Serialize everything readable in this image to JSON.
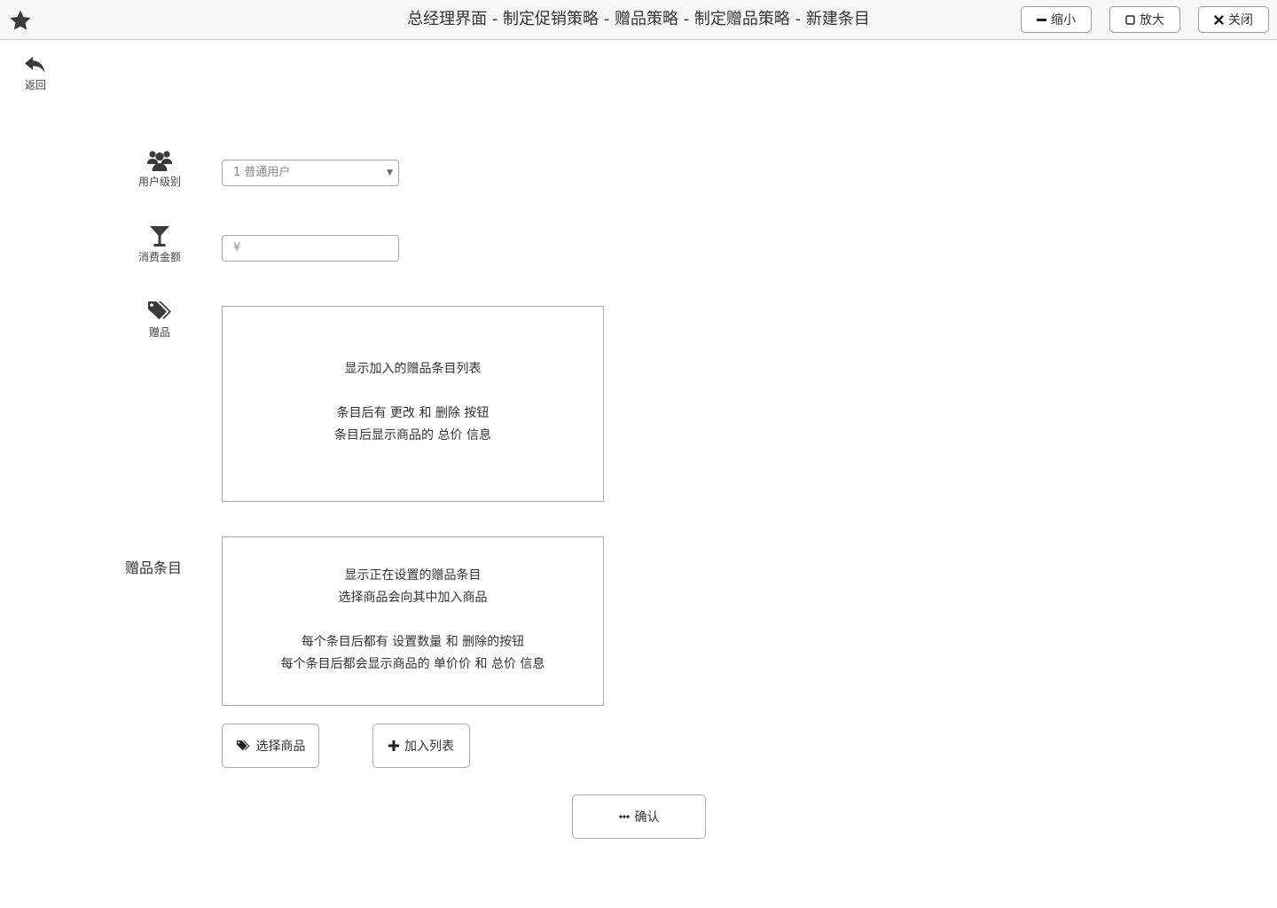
{
  "window": {
    "title": "总经理界面 - 制定促销策略 - 赠品策略 - 制定赠品策略 - 新建条目",
    "minimize_label": "缩小",
    "maximize_label": "放大",
    "close_label": "关闭"
  },
  "nav": {
    "back_label": "返回"
  },
  "form": {
    "user_level": {
      "label": "用户级别",
      "icon": "users-icon",
      "selected": "1 普通用户"
    },
    "amount": {
      "label": "消费金额",
      "icon": "cocktail-glass-icon",
      "placeholder": "¥"
    },
    "gift": {
      "label": "赠品",
      "icon": "tags-icon",
      "list_notes": [
        "显示加入的赠品条目列表",
        "",
        "条目后有 更改 和 删除 按钮",
        "条目后显示商品的 总价 信息"
      ]
    },
    "gift_entry": {
      "label": "赠品条目",
      "notes": [
        "显示正在设置的赠品条目",
        "选择商品会向其中加入商品",
        "",
        "每个条目后都有 设置数量 和 删除的按钮",
        "每个条目后都会显示商品的 单价价 和 总价 信息"
      ]
    }
  },
  "actions": {
    "select_goods_label": "选择商品",
    "add_to_list_label": "加入列表",
    "confirm_label": "确认"
  }
}
